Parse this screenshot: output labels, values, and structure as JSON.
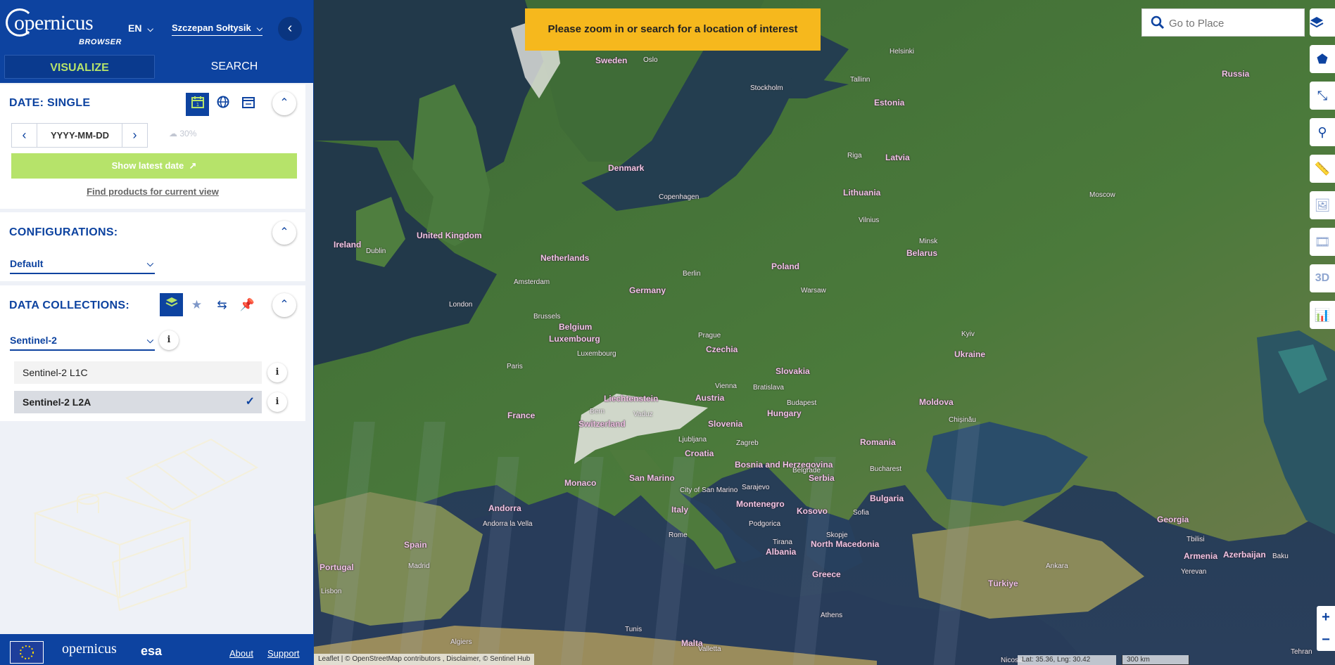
{
  "header": {
    "logo_text": "opernicus",
    "logo_sub": "BROWSER",
    "language": "EN",
    "user_name": "Szczepan Sołtysik",
    "collapse_icon": "chevron-left-icon"
  },
  "tabs": {
    "visualize": "VISUALIZE",
    "search": "SEARCH"
  },
  "date_panel": {
    "title": "DATE: SINGLE",
    "date_placeholder": "YYYY-MM-DD",
    "cloud_coverage": "30%",
    "show_latest": "Show latest date",
    "find_products": "Find products for current view"
  },
  "config_panel": {
    "title": "CONFIGURATIONS:",
    "selected": "Default"
  },
  "data_collections": {
    "title": "DATA COLLECTIONS:",
    "selected": "Sentinel-2",
    "items": [
      {
        "label": "Sentinel-2 L1C",
        "selected": false
      },
      {
        "label": "Sentinel-2 L2A",
        "selected": true
      }
    ]
  },
  "footer": {
    "copernicus": "opernicus",
    "esa": "esa",
    "about": "About",
    "support": "Support"
  },
  "map": {
    "banner": "Please zoom in or search for a location of interest",
    "search_placeholder": "Go to Place",
    "attribution": "Leaflet | © OpenStreetMap contributors , Disclaimer, © Sentinel Hub",
    "coords": "Lat: 35.36, Lng: 30.42",
    "scale": "300 km",
    "zoom_in": "+",
    "zoom_out": "−",
    "toolbar_3d": "3D",
    "countries": [
      "Sweden",
      "Denmark",
      "United Kingdom",
      "Ireland",
      "Netherlands",
      "Belgium",
      "Luxembourg",
      "Germany",
      "Poland",
      "Latvia",
      "Lithuania",
      "Estonia",
      "Belarus",
      "Ukraine",
      "Czechia",
      "Slovakia",
      "Austria",
      "Hungary",
      "Moldova",
      "Romania",
      "Slovenia",
      "Croatia",
      "Liechtenstein",
      "Switzerland",
      "France",
      "Bosnia and Herzegovina",
      "Serbia",
      "Bulgaria",
      "Montenegro",
      "Kosovo",
      "North Macedonia",
      "Albania",
      "Greece",
      "Italy",
      "San Marino",
      "Monaco",
      "Andorra",
      "Spain",
      "Portugal",
      "Malta",
      "Türkiye",
      "Georgia",
      "Armenia",
      "Azerbaijan",
      "Russia"
    ],
    "cities": [
      "Oslo",
      "Stockholm",
      "Helsinki",
      "Tallinn",
      "Riga",
      "Copenhagen",
      "Vilnius",
      "Minsk",
      "Moscow",
      "Dublin",
      "London",
      "Amsterdam",
      "Brussels",
      "Luxembourg",
      "Paris",
      "Berlin",
      "Warsaw",
      "Prague",
      "Kyiv",
      "Vienna",
      "Bratislava",
      "Budapest",
      "Bern",
      "Vaduz",
      "Ljubljana",
      "Zagreb",
      "Chișinău",
      "Belgrade",
      "Bucharest",
      "Sarajevo",
      "Podgorica",
      "Sofia",
      "Skopje",
      "Tirana",
      "Rome",
      "City of San Marino",
      "Andorra la Vella",
      "Madrid",
      "Lisbon",
      "Athens",
      "Ankara",
      "Tbilisi",
      "Yerevan",
      "Baku",
      "Valletta",
      "Tunis",
      "Algiers",
      "Nicosia",
      "Tehran"
    ]
  },
  "colors": {
    "brand_blue": "#0d43a0",
    "accent_green": "#b6e36a",
    "banner_yellow": "#f6b81d"
  }
}
